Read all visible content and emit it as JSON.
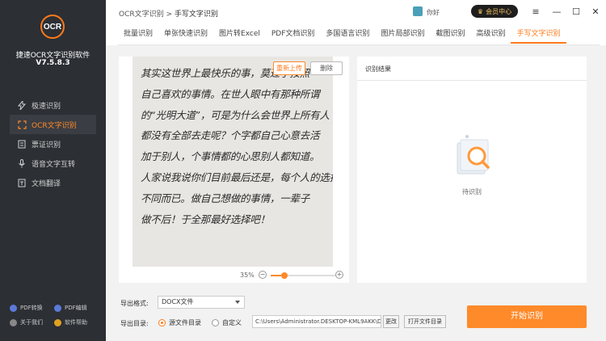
{
  "app": {
    "logo_text": "OCR",
    "name": "捷速OCR文字识别软件",
    "version": "V7.5.8.3"
  },
  "breadcrumb": {
    "root": "OCR文字识别",
    "separator": ">",
    "current": "手写文字识别"
  },
  "user": {
    "name": "你好",
    "vip_label": "会员中心"
  },
  "window": {
    "menu": "≡",
    "minimize": "—",
    "maximize": "☐",
    "close": "✕"
  },
  "sidebar": {
    "items": [
      {
        "label": "极速识别",
        "icon": "lightning-icon"
      },
      {
        "label": "OCR文字识别",
        "icon": "ocr-icon"
      },
      {
        "label": "票证识别",
        "icon": "ticket-icon"
      },
      {
        "label": "语音文字互转",
        "icon": "microphone-icon"
      },
      {
        "label": "文档翻译",
        "icon": "translate-icon"
      }
    ],
    "active_index": 1,
    "bottom": [
      {
        "label": "PDF转换"
      },
      {
        "label": "PDF编辑"
      },
      {
        "label": "关于我们"
      },
      {
        "label": "软件帮助"
      }
    ]
  },
  "tabs": [
    {
      "label": "批量识别"
    },
    {
      "label": "单张快速识别"
    },
    {
      "label": "图片转Excel"
    },
    {
      "label": "PDF文档识别"
    },
    {
      "label": "多国语言识别"
    },
    {
      "label": "图片局部识别"
    },
    {
      "label": "截图识别"
    },
    {
      "label": "高级识别"
    },
    {
      "label": "手写文字识别"
    }
  ],
  "active_tab": 8,
  "preview": {
    "reupload_label": "重新上传",
    "delete_label": "删除",
    "handwriting_lines": [
      "其实这世界上最快乐的事，莫过于按照",
      "自己喜欢的事情。在世人眼中有那种所谓",
      "的“光明大道”，可是为什么会世界上所有人",
      "都没有全部去走呢？个字都自己心意去活",
      "加于别人，个事情都的心思别人都知道。",
      "人家说我说你们目前最后还是，每个人的选择",
      "不同而已。做自己想做的事情，一辈子",
      "做不后！于全那最好选择吧！"
    ],
    "zoom_percent": "35%",
    "zoom_level": 0.35,
    "zoom_minus": "−",
    "zoom_plus": "+"
  },
  "result": {
    "title": "识别结果",
    "empty_text": "待识别"
  },
  "export": {
    "format_label": "导出格式:",
    "format_value": "DOCX文件",
    "dir_label": "导出目录:",
    "radio_source": "源文件目录",
    "radio_custom": "自定义",
    "path_value": "C:\\Users\\Administrator.DESKTOP-KML9AKK\\D",
    "change_label": "更改",
    "open_label": "打开文件目录",
    "start_label": "开始识别"
  },
  "colors": {
    "accent": "#ff8a2a",
    "sidebar_bg": "#2c2f34"
  }
}
